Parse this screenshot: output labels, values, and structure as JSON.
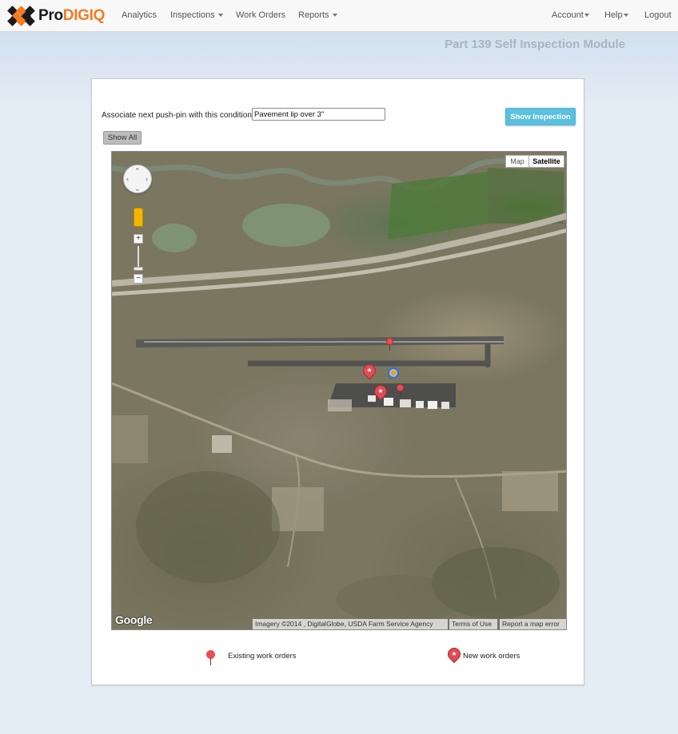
{
  "brand": {
    "name_part1": "Pro",
    "name_part2": "DIGIQ"
  },
  "nav": {
    "analytics": "Analytics",
    "inspections": "Inspections",
    "work_orders": "Work Orders",
    "reports": "Reports",
    "account": "Account",
    "help": "Help",
    "logout": "Logout"
  },
  "header": {
    "module_title": "Part 139 Self Inspection Module"
  },
  "form": {
    "assoc_label": "Associate next push-pin with this condition:",
    "condition_value": "Pavement lip over 3\"",
    "show_inspection_label": "Show Inspection",
    "show_all_label": "Show All"
  },
  "map": {
    "type_map": "Map",
    "type_satellite": "Satellite",
    "selected_type": "Satellite",
    "google": "Google",
    "imagery": "Imagery ©2014 , DigitalGlobe, USDA Farm Service Agency",
    "terms": "Terms of Use",
    "report": "Report a map error",
    "zoom_in": "+",
    "zoom_out": "−"
  },
  "legend": {
    "existing_label": "Existing work orders",
    "new_label": "New work orders"
  },
  "colors": {
    "brand_orange": "#f47b20",
    "pin_red": "#e14b53",
    "info_button": "#5bc0de"
  },
  "icons": {
    "logo": "logo-diamonds-icon",
    "existing_pin": "pushpin-icon",
    "new_pin": "map-marker-star-icon",
    "pan": "pan-arrows-icon",
    "pegman": "street-view-pegman-icon"
  }
}
